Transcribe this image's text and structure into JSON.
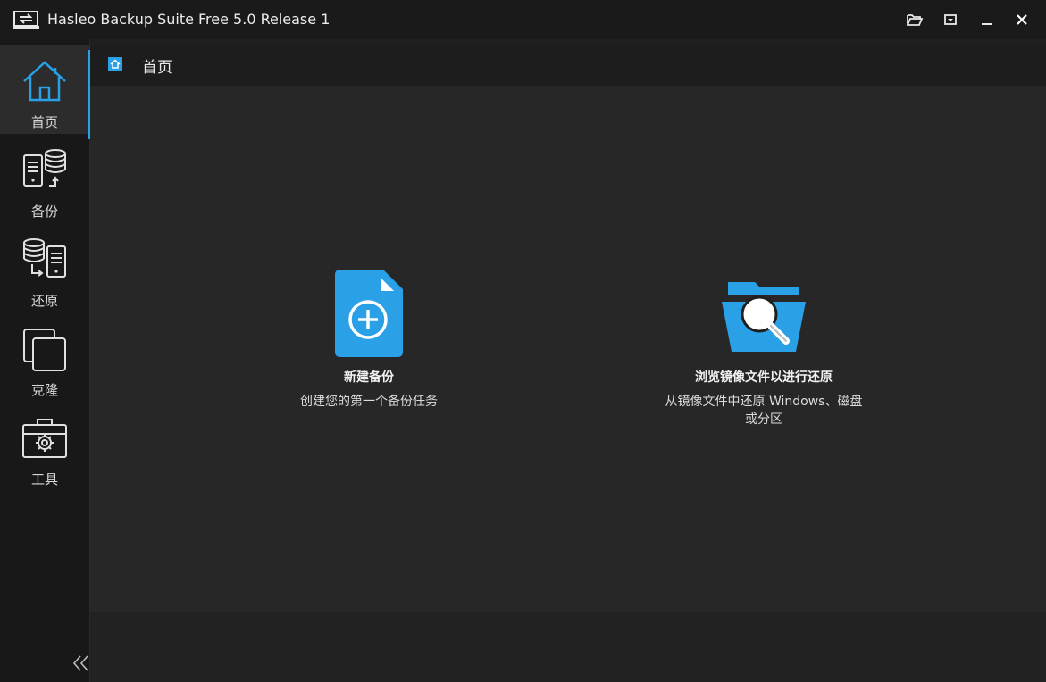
{
  "window": {
    "title": "Hasleo Backup Suite Free 5.0 Release 1"
  },
  "sidebar": {
    "items": [
      {
        "label": "首页",
        "icon": "home-icon",
        "active": true
      },
      {
        "label": "备份",
        "icon": "backup-icon",
        "active": false
      },
      {
        "label": "还原",
        "icon": "restore-icon",
        "active": false
      },
      {
        "label": "克隆",
        "icon": "clone-icon",
        "active": false
      },
      {
        "label": "工具",
        "icon": "tools-icon",
        "active": false
      }
    ],
    "collapse_icon": "double-chevron-left-icon"
  },
  "breadcrumb": {
    "icon": "home-small-icon",
    "text": "首页"
  },
  "cards": {
    "new_backup": {
      "icon": "new-file-plus-icon",
      "title": "新建备份",
      "desc": "创建您的第一个备份任务"
    },
    "browse_image": {
      "icon": "folder-search-icon",
      "title": "浏览镜像文件以进行还原",
      "desc_line1": "从镜像文件中还原 Windows、磁盘",
      "desc_line2": "或分区"
    }
  },
  "colors": {
    "accent": "#2aa0e6",
    "background": "#1f1f1f",
    "content": "#272727",
    "sidebar": "#181818"
  }
}
